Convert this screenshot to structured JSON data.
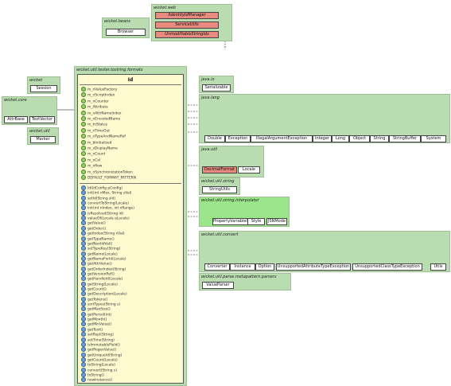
{
  "packages": {
    "wicket": {
      "title": "wicket",
      "classes": [
        "Session"
      ]
    },
    "wicket_core": {
      "title": "wicket.core",
      "classes": [
        "AttrBase",
        "TextVector"
      ]
    },
    "wicket_util": {
      "title": "wicket.util",
      "classes": [
        "Marker"
      ]
    },
    "ws_bean": {
      "title": "wicket.beans",
      "classes": [
        "Browser"
      ]
    },
    "ws_pkg_top": {
      "title": "wicket.web",
      "classes": [
        "IIdentityIdManager",
        "ServiceUtils",
        "UnmodifiableStringIds"
      ]
    },
    "main_pkg": {
      "title": "wicket.util.tester.tostring.formats"
    },
    "java_io": {
      "title": "java.io",
      "classes": [
        "Serializable"
      ]
    },
    "java_lang": {
      "title": "java.lang",
      "classes": [
        "Double",
        "Exception",
        "IllegalArgumentException",
        "Integer",
        "Long",
        "Object",
        "String",
        "StringBuffer",
        "System"
      ]
    },
    "java_util": {
      "title": "java.util",
      "classes": [
        "DecimalFormat",
        "Locale"
      ]
    },
    "wicket_util_string": {
      "title": "wicket.util.string",
      "classes": [
        "StringUtils"
      ]
    },
    "wicket_util_string_interp": {
      "title": "wicket.util.string.interpolator",
      "classes": [
        "PropertyVariableInterpolator",
        "Style",
        "JSNMode"
      ]
    },
    "wicket_util_conv": {
      "title": "wicket.util.convert",
      "classes": [
        "Converter",
        "Instance",
        "Option",
        "UnsupportedAttributeTypeException",
        "UnsupportedClassTypeException",
        "Utils"
      ]
    },
    "wicket_util_parse": {
      "title": "wicket.util.parse.metapattern.parsers",
      "classes": [
        "ValueParser"
      ]
    }
  },
  "main_class": {
    "name": "Id",
    "fields": [
      "m_nValueFactory",
      "m_nScriptIndex",
      "m_nCounter",
      "m_Attribute",
      "m_nAttrNameIndex",
      "m_nEncodedName",
      "m_tnStatus",
      "m_nTimeOut",
      "m_nTypeAndNameRef",
      "m_bInitialized",
      "m_sDisplayName",
      "m_nCount",
      "m_nCol",
      "m_nRow",
      "m_nSynchronizationToken",
      "DEFAULT_FORMAT_PATTERN"
    ],
    "methods": [
      "Id(IdConfig pConfig)",
      "init(int nMax, String sVal)",
      "setId(String sId)",
      "convertToString(Locale)",
      "init(int nIndex, int nRange)",
      "isResolved(String id)",
      "valueOf(Locale aLocale)",
      "getValue()",
      "getOrder()",
      "getIndex(String nVal)",
      "getTypeName()",
      "getNextIdVal()",
      "setTypeKey(String)",
      "getName(Locale)",
      "getNameForId(Locale)",
      "getAttrValue()",
      "getOrderIndex(String)",
      "getVersionRef()",
      "getHandleId(Locale)",
      "getString(Locale)",
      "getCount()",
      "getDescription(Locale)",
      "getTokens()",
      "sortTypes(String s)",
      "getMaxSize()",
      "getPeriod(int)",
      "getMonth()",
      "getMinValue()",
      "getText()",
      "setRepl(String)",
      "setTime(String)",
      "isImmutableField()",
      "getRegexValue()",
      "getUniqueId(String)",
      "getCount(Locale)",
      "toString(Locale)",
      "convert(String s)",
      "toString()",
      "newInstance()"
    ]
  }
}
